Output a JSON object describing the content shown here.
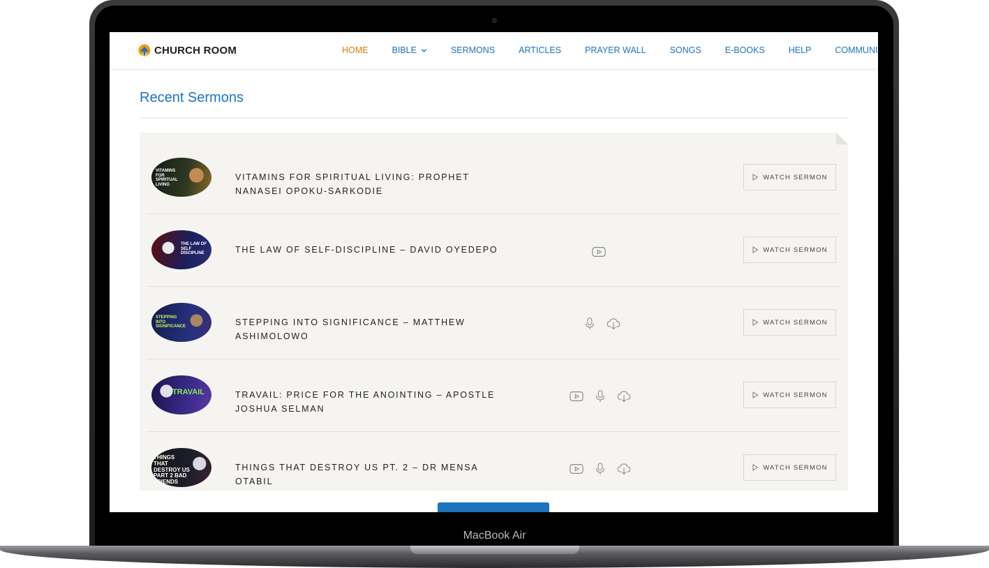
{
  "device": {
    "label": "MacBook Air"
  },
  "brand": {
    "name": "CHURCH ROOM",
    "accent": "#e07b0b",
    "link_color": "#1e73be"
  },
  "nav": {
    "items": [
      {
        "label": "HOME",
        "active": true,
        "dropdown": false
      },
      {
        "label": "BIBLE",
        "active": false,
        "dropdown": true
      },
      {
        "label": "SERMONS",
        "active": false,
        "dropdown": false
      },
      {
        "label": "ARTICLES",
        "active": false,
        "dropdown": false
      },
      {
        "label": "PRAYER WALL",
        "active": false,
        "dropdown": false
      },
      {
        "label": "SONGS",
        "active": false,
        "dropdown": false
      },
      {
        "label": "E-BOOKS",
        "active": false,
        "dropdown": false
      },
      {
        "label": "HELP",
        "active": false,
        "dropdown": false
      },
      {
        "label": "COMMUNITY",
        "active": false,
        "dropdown": true
      }
    ]
  },
  "main": {
    "section_title": "Recent Sermons",
    "sermons": [
      {
        "title": "VITAMINS FOR SPIRITUAL LIVING: PROPHET NANASEI OPOKU-SARKODIE",
        "thumb_text": "VITAMINS FOR SPIRITUAL LIVING",
        "media": [],
        "button": "WATCH SERMON"
      },
      {
        "title": "THE LAW OF SELF-DISCIPLINE – DAVID OYEDEPO",
        "thumb_text": "THE LAW OF SELF DISCIPLINE",
        "media": [
          "video-icon"
        ],
        "button": "WATCH SERMON"
      },
      {
        "title": "STEPPING INTO SIGNIFICANCE – MATTHEW ASHIMOLOWO",
        "thumb_text": "STEPPING INTO SIGNIFICANCE",
        "media": [
          "microphone-icon",
          "cloud-download-icon"
        ],
        "button": "WATCH SERMON"
      },
      {
        "title": "TRAVAIL: PRICE FOR THE ANOINTING – APOSTLE JOSHUA SELMAN",
        "thumb_text": "TRAVAIL",
        "media": [
          "video-icon",
          "microphone-icon",
          "cloud-download-icon"
        ],
        "button": "WATCH SERMON"
      },
      {
        "title": "THINGS THAT DESTROY US PT. 2 – DR MENSA OTABIL",
        "thumb_text": "THINGS THAT DESTROY US PART 2 BAD FRIENDS",
        "media": [
          "video-icon",
          "microphone-icon",
          "cloud-download-icon"
        ],
        "button": "WATCH SERMON"
      }
    ]
  }
}
